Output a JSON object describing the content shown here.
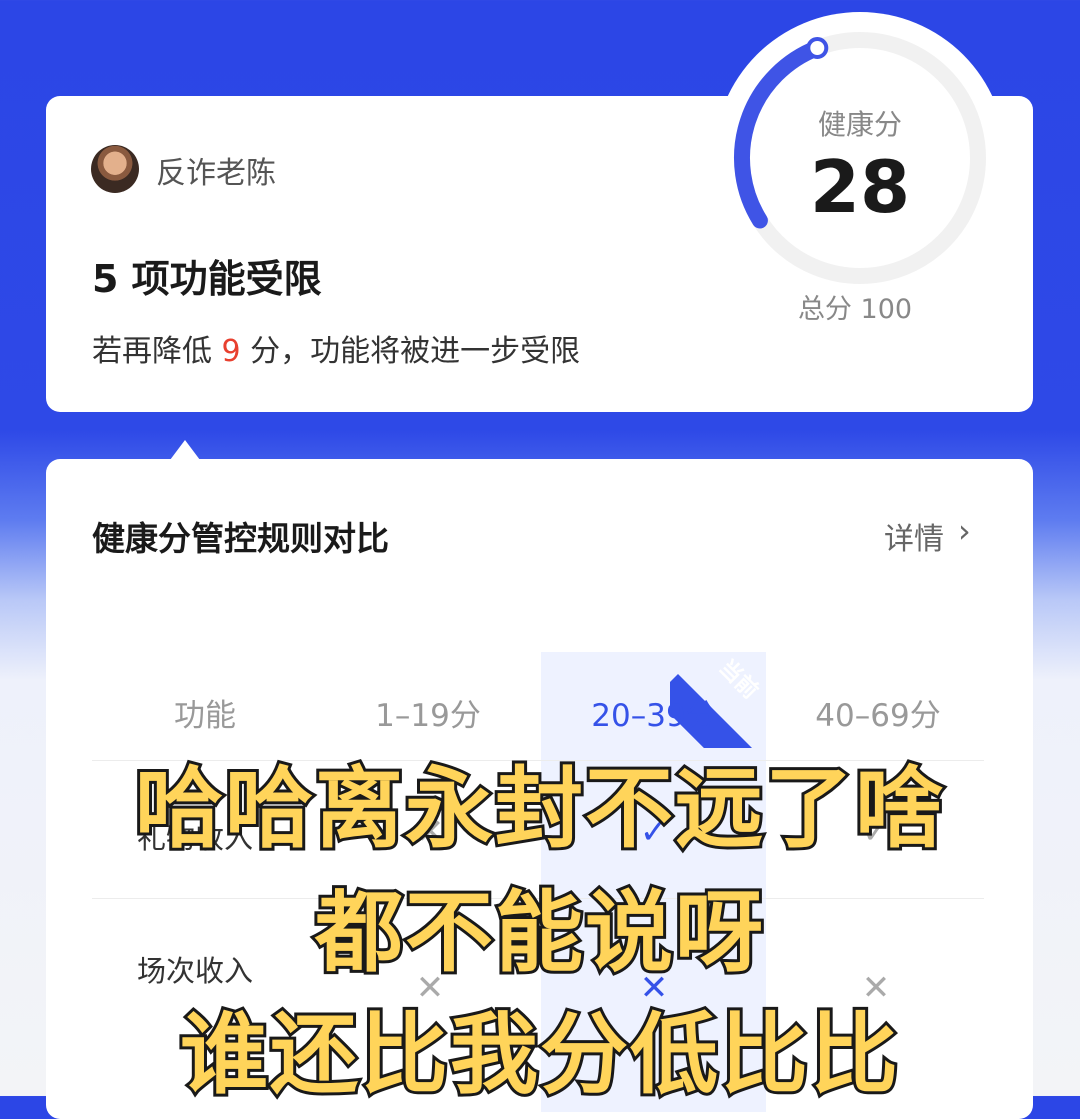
{
  "profile": {
    "username": "反诈老陈"
  },
  "status": {
    "limit_title": "5 项功能受限",
    "warn_prefix": "若再降低 ",
    "warn_points": "9",
    "warn_suffix": " 分，功能将被进一步受限"
  },
  "gauge": {
    "label": "健康分",
    "score": "28",
    "total": "总分 100",
    "score_value": 28,
    "max_value": 100
  },
  "rules": {
    "title": "健康分管控规则对比",
    "details_label": "详情",
    "details_icon": "chevron-right-icon",
    "current_badge": "当前",
    "columns": [
      "功能",
      "1–19分",
      "20–39分",
      "40–69分"
    ],
    "rows": [
      {
        "label": "礼物收入",
        "marks": [
          "cross",
          "check",
          "check"
        ]
      },
      {
        "label": "场次收入",
        "marks": [
          "cross",
          "cross",
          "cross"
        ]
      }
    ]
  },
  "captions": [
    "哈哈离永封不远了啥",
    "都不能说呀",
    "谁还比我分低比比"
  ],
  "colors": {
    "brand_blue": "#3552e8",
    "warn_red": "#e8402f",
    "caption_yellow": "#ffd45a"
  }
}
